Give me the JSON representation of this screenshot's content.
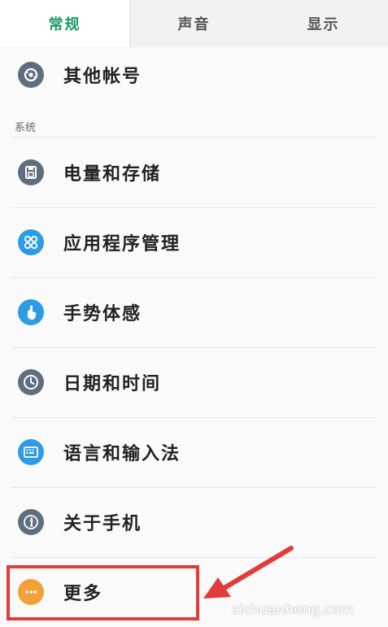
{
  "tabs": [
    {
      "label": "常规",
      "active": true
    },
    {
      "label": "声音",
      "active": false
    },
    {
      "label": "显示",
      "active": false
    }
  ],
  "top_item": {
    "label": "其他帐号",
    "icon": "sync-account-icon"
  },
  "section": {
    "label": "系统"
  },
  "items": [
    {
      "label": "电量和存储",
      "icon": "battery-storage-icon"
    },
    {
      "label": "应用程序管理",
      "icon": "app-grid-icon"
    },
    {
      "label": "手势体感",
      "icon": "gesture-hand-icon"
    },
    {
      "label": "日期和时间",
      "icon": "clock-icon"
    },
    {
      "label": "语言和输入法",
      "icon": "keyboard-icon"
    },
    {
      "label": "关于手机",
      "icon": "info-icon"
    },
    {
      "label": "更多",
      "icon": "more-dots-icon"
    }
  ],
  "watermark": "sichuanhong.com",
  "colors": {
    "accent": "#1a9a66",
    "highlight": "#e23b3b",
    "grey_icon": "#5f6e7e",
    "blue_icon": "#2d9be6",
    "orange_icon": "#f2a13a"
  }
}
